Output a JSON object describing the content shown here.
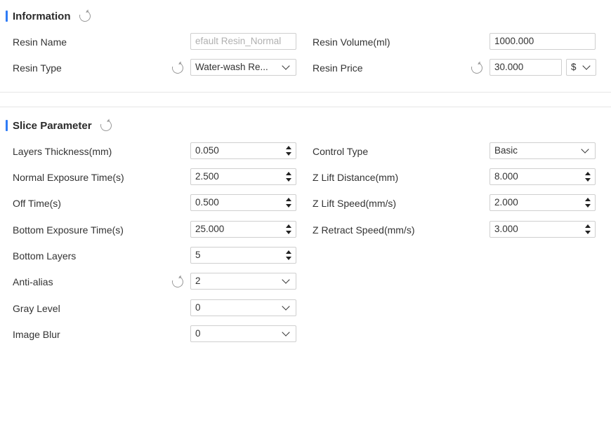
{
  "information": {
    "title": "Information",
    "resin_name": {
      "label": "Resin Name",
      "value": "efault Resin_Normal"
    },
    "resin_type": {
      "label": "Resin Type",
      "value": "Water-wash Re..."
    },
    "resin_volume": {
      "label": "Resin Volume(ml)",
      "value": "1000.000"
    },
    "resin_price": {
      "label": "Resin Price",
      "value": "30.000",
      "currency": "$"
    }
  },
  "slice": {
    "title": "Slice Parameter",
    "layers_thickness": {
      "label": "Layers Thickness(mm)",
      "value": "0.050"
    },
    "normal_exposure": {
      "label": "Normal Exposure Time(s)",
      "value": "2.500"
    },
    "off_time": {
      "label": "Off Time(s)",
      "value": "0.500"
    },
    "bottom_exposure": {
      "label": "Bottom Exposure Time(s)",
      "value": "25.000"
    },
    "bottom_layers": {
      "label": "Bottom Layers",
      "value": "5"
    },
    "anti_alias": {
      "label": "Anti-alias",
      "value": "2"
    },
    "gray_level": {
      "label": "Gray Level",
      "value": "0"
    },
    "image_blur": {
      "label": "Image Blur",
      "value": "0"
    },
    "control_type": {
      "label": "Control Type",
      "value": "Basic"
    },
    "z_lift_distance": {
      "label": "Z Lift Distance(mm)",
      "value": "8.000"
    },
    "z_lift_speed": {
      "label": "Z Lift Speed(mm/s)",
      "value": "2.000"
    },
    "z_retract_speed": {
      "label": "Z Retract Speed(mm/s)",
      "value": "3.000"
    }
  },
  "colors": {
    "accent": "#2f7cf6"
  },
  "icons": {
    "refresh": "refresh-icon",
    "spinner": "spinner-arrows-icon",
    "dropdown": "chevron-down-icon"
  }
}
